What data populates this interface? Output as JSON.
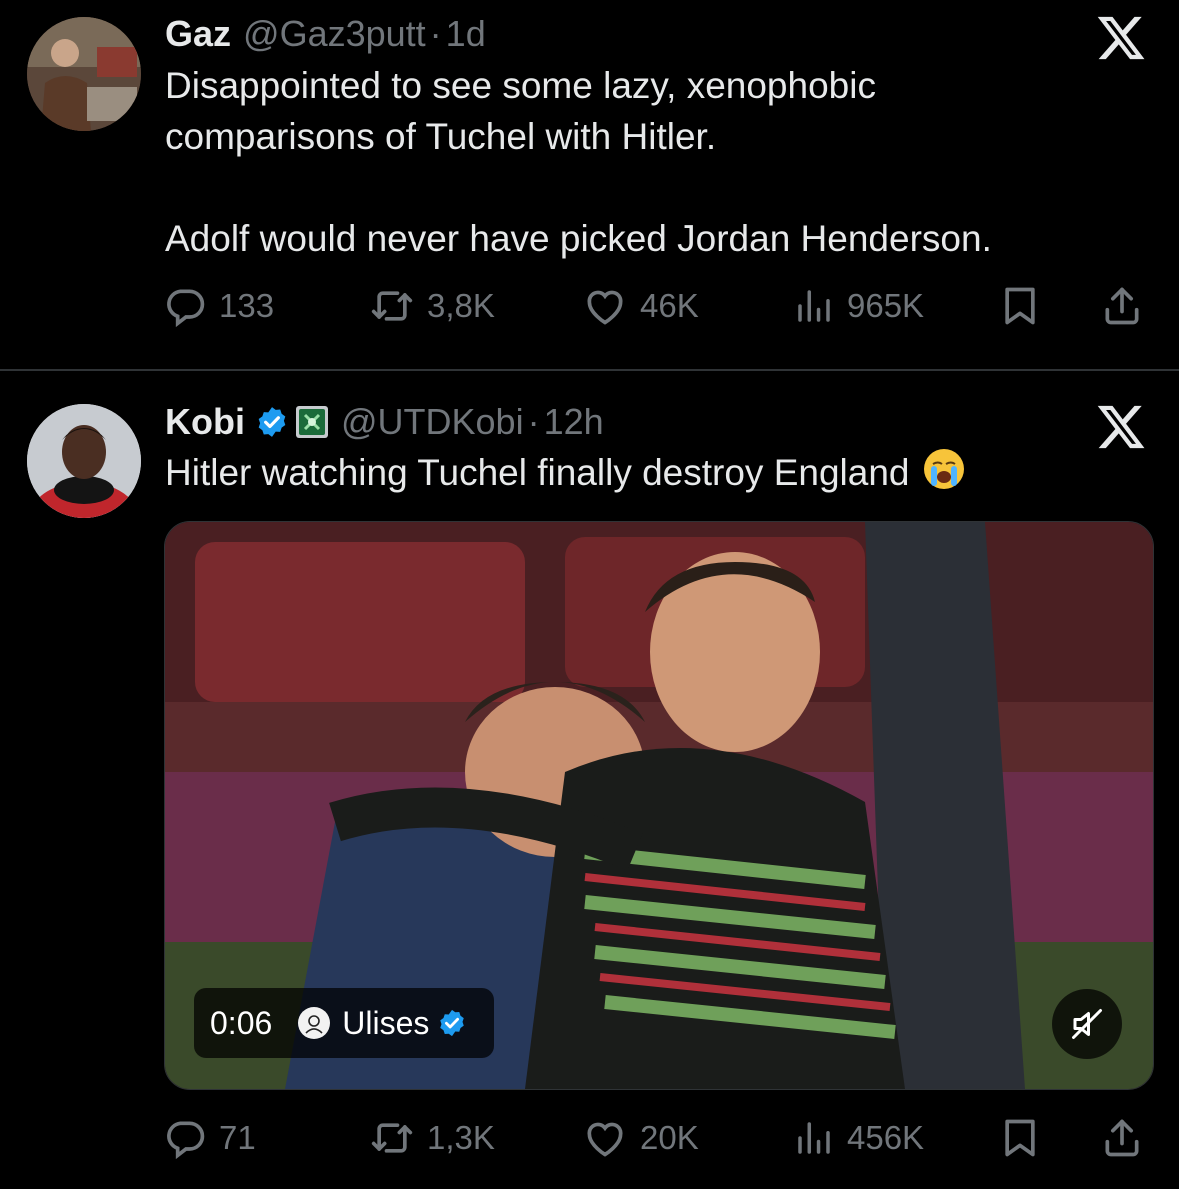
{
  "tweets": [
    {
      "author": "Gaz",
      "handle": "@Gaz3putt",
      "separator": "·",
      "time": "1d",
      "text_lines": [
        "Disappointed to see some lazy, xenophobic",
        "comparisons of Tuchel with Hitler.",
        "Adolf would never have picked Jordan Henderson."
      ],
      "stats": {
        "replies": "133",
        "reposts": "3,8K",
        "likes": "46K",
        "views": "965K"
      }
    },
    {
      "author": "Kobi",
      "handle": "@UTDKobi",
      "separator": "·",
      "time": "12h",
      "verified": true,
      "text": "Hitler watching Tuchel finally destroy England",
      "emoji": "loudly-crying-face",
      "media": {
        "type": "video",
        "duration": "0:06",
        "source_name": "Ulises",
        "source_verified": true,
        "muted": true
      },
      "stats": {
        "replies": "71",
        "reposts": "1,3K",
        "likes": "20K",
        "views": "456K"
      }
    }
  ],
  "colors": {
    "background": "#000000",
    "text": "#e7e9ea",
    "muted": "#71767b",
    "verified": "#1d9bf0",
    "divider": "#2f3336"
  },
  "icons": [
    "x-logo-icon",
    "reply-icon",
    "repost-icon",
    "like-icon",
    "views-icon",
    "bookmark-icon",
    "share-icon",
    "verified-badge-icon",
    "mute-icon"
  ]
}
